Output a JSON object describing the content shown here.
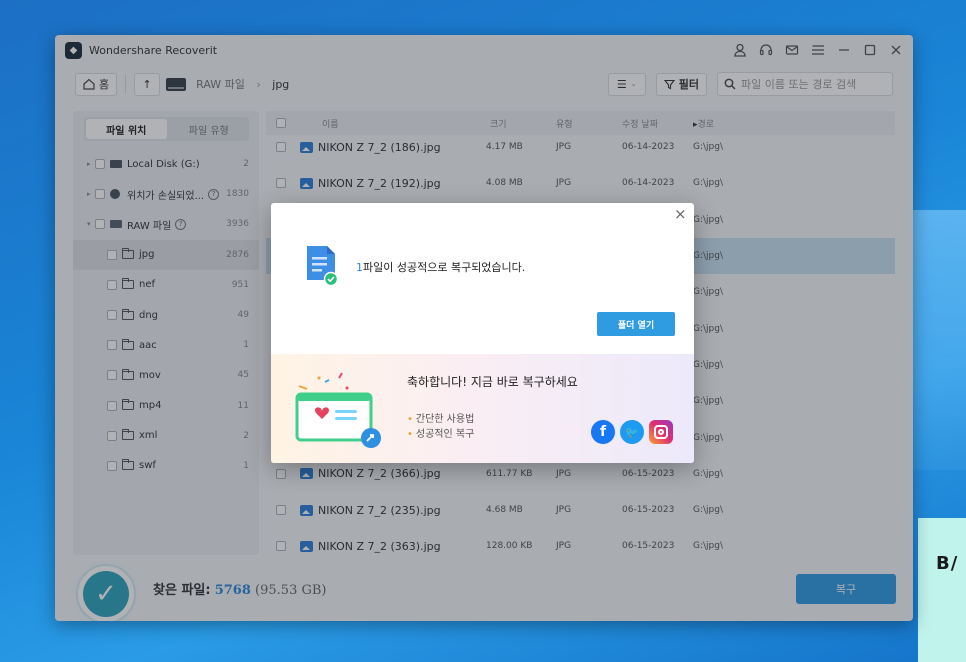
{
  "app": {
    "title": "Wondershare Recoverit"
  },
  "toolbar": {
    "home_label": "홈",
    "breadcrumb": [
      "RAW 파일",
      "jpg"
    ],
    "filter_label": "필터",
    "search_placeholder": "파일 이름 또는 경로 검색"
  },
  "sidebar": {
    "tabs": [
      "파일 위치",
      "파일 유형"
    ],
    "items": [
      {
        "label": "Local Disk (G:)",
        "count": "2"
      },
      {
        "label": "위치가 손실되었...",
        "count": "1830"
      },
      {
        "label": "RAW 파일",
        "count": "3936"
      },
      {
        "label": "jpg",
        "count": "2876"
      },
      {
        "label": "nef",
        "count": "951"
      },
      {
        "label": "dng",
        "count": "49"
      },
      {
        "label": "aac",
        "count": "1"
      },
      {
        "label": "mov",
        "count": "45"
      },
      {
        "label": "mp4",
        "count": "11"
      },
      {
        "label": "xml",
        "count": "2"
      },
      {
        "label": "swf",
        "count": "1"
      }
    ]
  },
  "filelist": {
    "headers": {
      "name": "이름",
      "size": "크기",
      "type": "유형",
      "date": "수정 날짜",
      "path": "경로"
    },
    "rows": [
      {
        "name": "NIKON Z 7_2 (186).jpg",
        "size": "4.17 MB",
        "type": "JPG",
        "date": "06-14-2023",
        "path": "G:\\jpg\\"
      },
      {
        "name": "NIKON Z 7_2 (192).jpg",
        "size": "4.08 MB",
        "type": "JPG",
        "date": "06-14-2023",
        "path": "G:\\jpg\\"
      },
      {
        "name": "",
        "size": "",
        "type": "",
        "date": "",
        "path": "G:\\jpg\\"
      },
      {
        "name": "",
        "size": "",
        "type": "",
        "date": "",
        "path": "G:\\jpg\\"
      },
      {
        "name": "",
        "size": "",
        "type": "",
        "date": "",
        "path": "G:\\jpg\\"
      },
      {
        "name": "",
        "size": "",
        "type": "",
        "date": "",
        "path": "G:\\jpg\\"
      },
      {
        "name": "",
        "size": "",
        "type": "",
        "date": "",
        "path": "G:\\jpg\\"
      },
      {
        "name": "",
        "size": "",
        "type": "",
        "date": "",
        "path": "G:\\jpg\\"
      },
      {
        "name": "",
        "size": "",
        "type": "",
        "date": "",
        "path": "G:\\jpg\\"
      },
      {
        "name": "NIKON Z 7_2 (366).jpg",
        "size": "611.77 KB",
        "type": "JPG",
        "date": "06-15-2023",
        "path": "G:\\jpg\\"
      },
      {
        "name": "NIKON Z 7_2 (235).jpg",
        "size": "4.68 MB",
        "type": "JPG",
        "date": "06-15-2023",
        "path": "G:\\jpg\\"
      },
      {
        "name": "NIKON Z 7_2 (363).jpg",
        "size": "128.00 KB",
        "type": "JPG",
        "date": "06-15-2023",
        "path": "G:\\jpg\\"
      }
    ]
  },
  "footer": {
    "found_label": "찾은 파일:",
    "found_count": "5768",
    "found_size": "(95.53 GB)",
    "recover_label": "복구"
  },
  "dialog": {
    "count": "1",
    "message": "파일이 성공적으로 복구되었습니다.",
    "open_folder_label": "폴더 열기",
    "promo_title": "축하합니다! 지금 바로 복구하세요",
    "promo_items": [
      "간단한 사용법",
      "성공적인 복구"
    ]
  },
  "desktop": {
    "card_text": "B/"
  },
  "colors": {
    "accent": "#2f9be0",
    "highlight_row": "#c8dff0",
    "success": "#2fa3bb"
  }
}
